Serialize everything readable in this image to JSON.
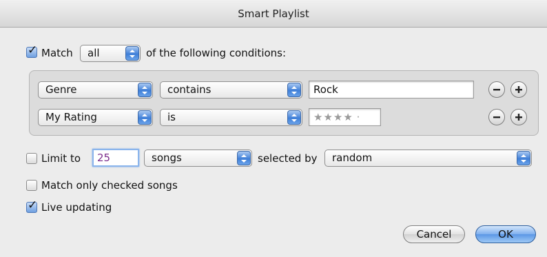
{
  "window": {
    "title": "Smart Playlist"
  },
  "match": {
    "checked": true,
    "label": "Match",
    "mode": "all",
    "suffix": "of the following conditions:"
  },
  "conditions": [
    {
      "field": "Genre",
      "operator": "contains",
      "value": "Rock"
    },
    {
      "field": "My Rating",
      "operator": "is",
      "value_stars": "★★★★",
      "value_empty": "·"
    }
  ],
  "limit": {
    "checked": false,
    "label": "Limit to",
    "value": "25",
    "unit": "songs",
    "selected_by_label": "selected by",
    "selected_by": "random"
  },
  "match_checked": {
    "checked": false,
    "label": "Match only checked songs"
  },
  "live_updating": {
    "checked": true,
    "label": "Live updating"
  },
  "buttons": {
    "cancel": "Cancel",
    "ok": "OK"
  },
  "colors": {
    "accent": "#5b97e6",
    "background": "#ececec"
  }
}
